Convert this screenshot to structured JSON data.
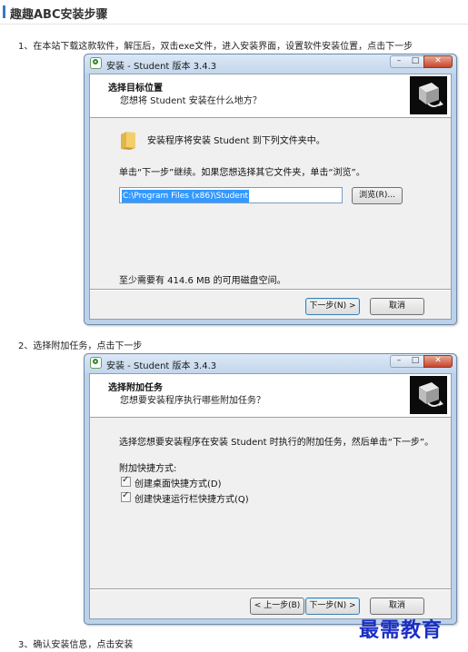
{
  "page": {
    "title": "趣趣ABC安装步骤"
  },
  "steps": [
    "1、在本站下载这款软件，解压后，双击exe文件，进入安装界面，设置软件安装位置，点击下一步",
    "2、选择附加任务，点击下一步",
    "3、确认安装信息，点击安装"
  ],
  "window1": {
    "title": "安装 - Student 版本 3.4.3",
    "header_title": "选择目标位置",
    "header_subtitle": "您想将 Student 安装在什么地方？",
    "install_line": "安装程序将安装 Student 到下列文件夹中。",
    "continue_line": "单击“下一步”继续。如果您想选择其它文件夹，单击“浏览”。",
    "path_value": "C:\\Program Files (x86)\\Student",
    "browse_label": "浏览(R)...",
    "disk_space": "至少需要有 414.6 MB 的可用磁盘空间。",
    "next_label": "下一步(N) >",
    "cancel_label": "取消"
  },
  "window2": {
    "title": "安装 - Student 版本 3.4.3",
    "header_title": "选择附加任务",
    "header_subtitle": "您想要安装程序执行哪些附加任务？",
    "instruction": "选择您想要安装程序在安装 Student 时执行的附加任务，然后单击“下一步”。",
    "group_label": "附加快捷方式:",
    "options": [
      {
        "label": "创建桌面快捷方式(D)",
        "checked": true
      },
      {
        "label": "创建快速运行栏快捷方式(Q)",
        "checked": true
      }
    ],
    "back_label": "< 上一步(B)",
    "next_label": "下一步(N) >",
    "cancel_label": "取消"
  },
  "watermark": "最需教育"
}
